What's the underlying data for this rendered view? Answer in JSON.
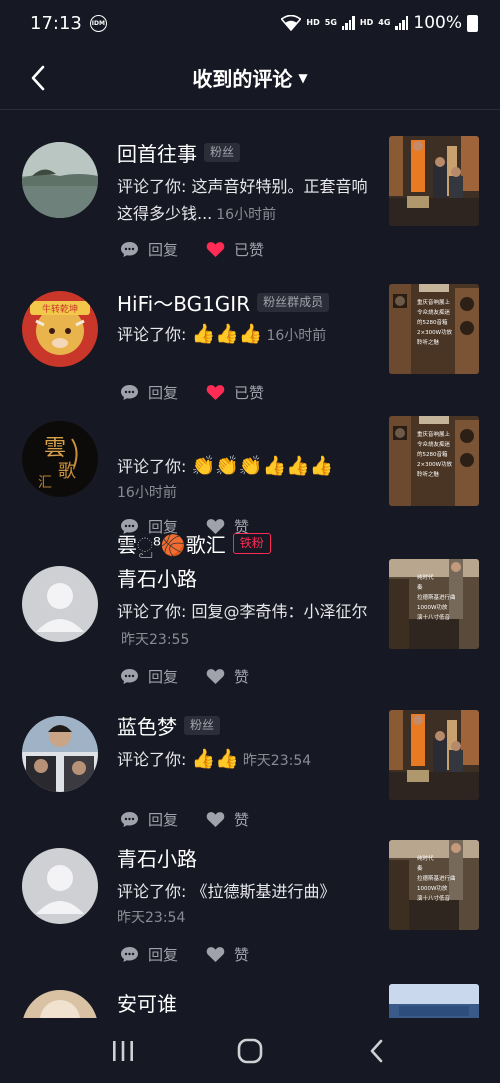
{
  "status": {
    "time": "17:13",
    "idm": "IDM",
    "hd1": "HD",
    "net1": "5G",
    "hd2": "HD",
    "net2": "4G",
    "battery": "100%"
  },
  "header": {
    "title": "收到的评论"
  },
  "actions": {
    "reply": "回复",
    "liked": "已赞",
    "like": "赞"
  },
  "comments": [
    {
      "name": "回首往事",
      "badge": "粉丝",
      "prefix": "评论了你: ",
      "text": "这声音好特别。正套音响这得多少钱...",
      "time": "16小时前",
      "liked": true
    },
    {
      "name": "HiFi～BG1GIR",
      "badge": "粉丝群成员",
      "prefix": "评论了你: ",
      "text": "👍👍👍",
      "time": "16小时前",
      "liked": true
    },
    {
      "name": "雲ු⁸🏀歌汇",
      "badge": "铁粉",
      "prefix": "评论了你: ",
      "text": "👏👏👏👍👍👍",
      "time": "16小时前",
      "liked": false
    },
    {
      "name": "青石小路",
      "badge": "",
      "prefix": "评论了你: ",
      "text": "回复@李奇伟：小泽征尔",
      "time": "昨天23:55",
      "liked": false
    },
    {
      "name": "蓝色梦",
      "badge": "粉丝",
      "prefix": "评论了你: ",
      "text": "👍👍",
      "time": "昨天23:54",
      "liked": false
    },
    {
      "name": "青石小路",
      "badge": "",
      "prefix": "评论了你: ",
      "text": "《拉德斯基进行曲》",
      "time": "昨天23:54",
      "liked": false
    },
    {
      "name": "安可谁",
      "badge": "",
      "prefix": "",
      "text": "",
      "time": "",
      "liked": false
    }
  ],
  "thumbs": {
    "t2": [
      "重庆音响展上",
      "令众烧友痴迷",
      "的5280音箱",
      "2×300W功放",
      "聆听之魅"
    ],
    "t4": [
      "纯时代",
      "奏",
      "拉德斯基进行曲",
      "1000W功放",
      "演十八寸低音"
    ],
    "t6": [
      "纯时代",
      "奏",
      "拉德斯基进行曲",
      "1000W功放",
      "演十八寸低音"
    ]
  },
  "icons": {
    "back": "back-arrow-icon",
    "caret": "caret-down-icon",
    "reply": "comment-bubble-icon",
    "like": "heart-icon"
  },
  "colors": {
    "background": "#161823",
    "like_active": "#fe2c55",
    "muted": "#a0a2ab"
  }
}
